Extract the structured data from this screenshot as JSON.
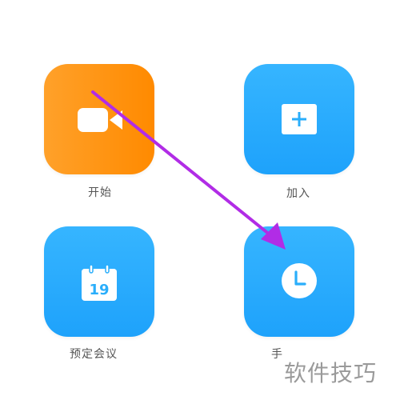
{
  "actions": {
    "start": {
      "label": "开始",
      "icon": "video-camera-icon",
      "color": "#ff9416"
    },
    "join": {
      "label": "加入",
      "icon": "plus-icon",
      "color": "#2aaefb"
    },
    "schedule": {
      "label": "预定会议",
      "icon": "calendar-icon",
      "date": "19",
      "color": "#2aaefb"
    },
    "share": {
      "label": "手",
      "icon": "clock-icon",
      "color": "#2aaefb"
    }
  },
  "annotation": {
    "color": "#b12ce6"
  },
  "watermark": "软件技巧"
}
